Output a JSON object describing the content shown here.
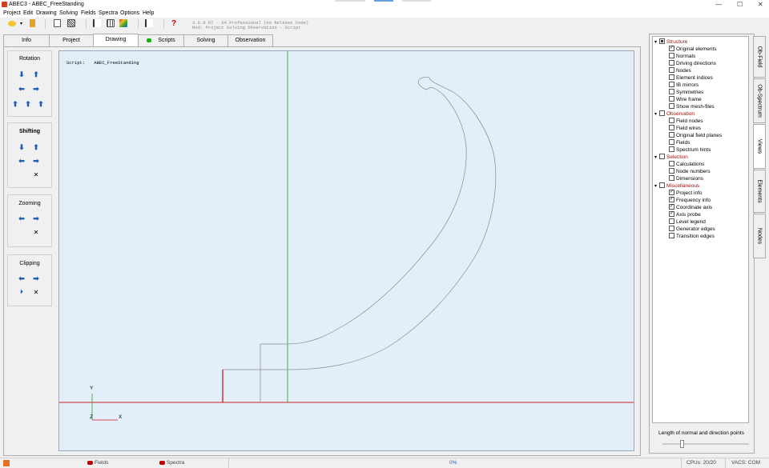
{
  "window": {
    "title": "ABEC3 - ABEC_FreeStanding",
    "minimize": "—",
    "maximize": "☐",
    "close": "✕"
  },
  "menu": [
    "Project",
    "Edit",
    "Drawing",
    "Solving",
    "Fields",
    "Spectra",
    "Options",
    "Help"
  ],
  "toolbar": {
    "version_line1": "3.6.0 b7 - 64 Professional (no Release Code)",
    "version_line2": "Mod: Project Solving Observation - Script",
    "help": "?"
  },
  "tabs": [
    "Info",
    "Project",
    "Drawing",
    "Scripts",
    "Solving",
    "Observation"
  ],
  "active_tab": "Drawing",
  "left_panel": {
    "rotation": {
      "title": "Rotation"
    },
    "shifting": {
      "title": "Shifting"
    },
    "zooming": {
      "title": "Zooming"
    },
    "clipping": {
      "title": "Clipping"
    }
  },
  "canvas": {
    "script_label": "Script:",
    "script_name": "ABEC_FreeStanding",
    "axis_y": "Y",
    "axis_z": "Z",
    "axis_x": "X"
  },
  "tree": [
    {
      "label": "Structure",
      "type": "category",
      "state": "partial"
    },
    {
      "label": "Original elements",
      "checked": true
    },
    {
      "label": "Normals",
      "checked": false
    },
    {
      "label": "Driving directions",
      "checked": false
    },
    {
      "label": "Nodes",
      "checked": false
    },
    {
      "label": "Element indices",
      "checked": false
    },
    {
      "label": "IB mirrors",
      "checked": false
    },
    {
      "label": "Symmetries",
      "checked": false
    },
    {
      "label": "Wire frame",
      "checked": false
    },
    {
      "label": "Show mesh-files",
      "checked": false
    },
    {
      "label": "Observation",
      "type": "category",
      "state": "unchecked"
    },
    {
      "label": "Field nodes",
      "checked": false
    },
    {
      "label": "Field wires",
      "checked": false
    },
    {
      "label": "Original field planes",
      "checked": false
    },
    {
      "label": "Fields",
      "checked": false
    },
    {
      "label": "Spectrum hints",
      "checked": false
    },
    {
      "label": "Selection",
      "type": "category",
      "state": "unchecked"
    },
    {
      "label": "Calculations",
      "checked": false
    },
    {
      "label": "Node numbers",
      "checked": false
    },
    {
      "label": "Dimensions",
      "checked": false
    },
    {
      "label": "Miscellaneous",
      "type": "category",
      "state": "unchecked"
    },
    {
      "label": "Project info",
      "checked": true
    },
    {
      "label": "Frequency info",
      "checked": true
    },
    {
      "label": "Coordinate axis",
      "checked": true
    },
    {
      "label": "Axis probe",
      "checked": true
    },
    {
      "label": "Level legend",
      "checked": false
    },
    {
      "label": "Generator edges",
      "checked": false
    },
    {
      "label": "Transition edges",
      "checked": false
    }
  ],
  "side_tabs": [
    "Ob-Field",
    "Ob-Spectrum",
    "Views",
    "Elements",
    "Nodes"
  ],
  "active_side_tab": "Views",
  "slider": {
    "label": "Length of normal and direction points",
    "value": 0.22
  },
  "status": {
    "fields": "Fields",
    "spectra": "Spectra",
    "progress": "0%",
    "cpus": "CPUs: 20/20",
    "vacs": "VACS: COM"
  },
  "colors": {
    "accent": "#1a5fb4",
    "canvas_bg": "#e2eef9",
    "category": "#a01010"
  }
}
